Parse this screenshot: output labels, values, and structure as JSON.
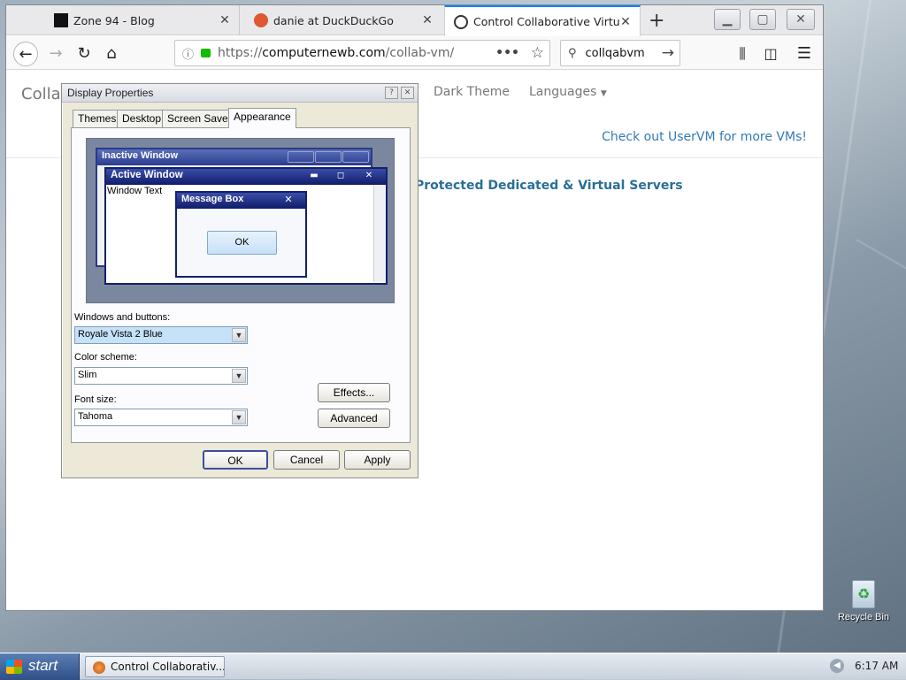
{
  "browser": {
    "tabs": [
      {
        "title": "Zone 94 - Blog"
      },
      {
        "title": "danie at DuckDuckGo"
      },
      {
        "title": "Control Collaborative Virtual M"
      }
    ],
    "url_prefix": "https://",
    "url_domain": "computernewb.com",
    "url_path": "/collab-vm/",
    "search_value": "collqabvm"
  },
  "page": {
    "brand": "Collab",
    "nav_dark_theme": "Dark Theme",
    "nav_languages": "Languages",
    "link_uservm": "Check out UserVM for more VMs!",
    "banner": "Protected Dedicated & Virtual Servers"
  },
  "dialog": {
    "title": "Display Properties",
    "tabs": [
      "Themes",
      "Desktop",
      "Screen Saver",
      "Appearance"
    ],
    "preview": {
      "inactive_title": "Inactive Window",
      "active_title": "Active Window",
      "window_text": "Window Text",
      "msgbox_title": "Message Box",
      "ok": "OK"
    },
    "windows_buttons_label": "Windows and buttons:",
    "windows_buttons_value": "Royale Vista 2 Blue",
    "color_scheme_label": "Color scheme:",
    "color_scheme_value": "Slim",
    "font_size_label": "Font size:",
    "font_size_value": "Tahoma",
    "effects": "Effects...",
    "advanced": "Advanced",
    "ok": "OK",
    "cancel": "Cancel",
    "apply": "Apply"
  },
  "desktop": {
    "recycle_bin": "Recycle Bin"
  },
  "taskbar": {
    "start": "start",
    "task": "Control Collaborativ...",
    "time": "6:17 AM"
  }
}
